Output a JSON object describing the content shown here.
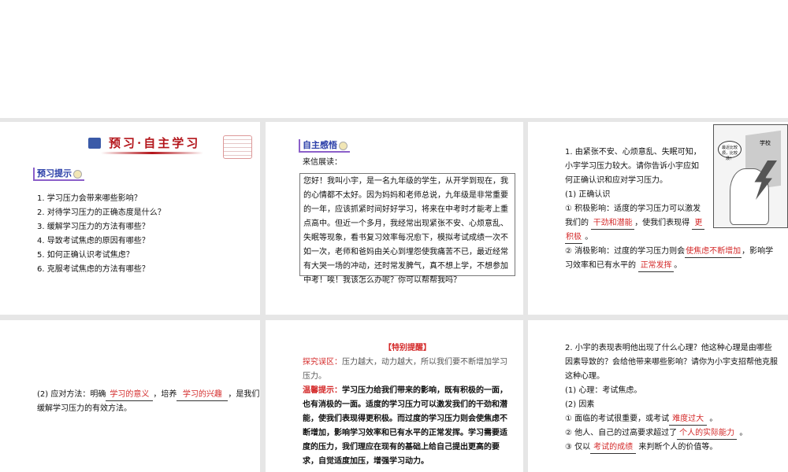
{
  "slide1": {
    "banner": "预习·自主学习",
    "section": "预习提示",
    "items": [
      "1. 学习压力会带来哪些影响？",
      "2. 对待学习压力的正确态度是什么？",
      "3. 缓解学习压力的方法有哪些？",
      "4. 导致考试焦虑的原因有哪些？",
      "5. 如何正确认识考试焦虑？",
      "6. 克服考试焦虑的方法有哪些？"
    ]
  },
  "slide2": {
    "section": "自主感悟",
    "intro": "来信展读：",
    "letter": "您好！我叫小宇，是一名九年级的学生，从开学到现在，我的心情都不太好。因为妈妈和老师总说，九年级是非常重要的一年，应该抓紧时间好好学习，将来在中考时才能考上重点高中。但近一个多月，我经常出现紧张不安、心烦意乱、失眠等现象，看书复习效率每况愈下，模拟考试成绩一次不如一次，老师和爸妈由关心到埋怨使我痛苦不已，最近经常有大哭一场的冲动，还时常发脾气，真不想上学，不想参加中考！唉！我该怎么办呢？你可以帮帮我吗？"
  },
  "slide3": {
    "q1": "1. 由紧张不安、心烦意乱、失眠可知，",
    "q2": "小宇学习压力较大。请你告诉小宇应如",
    "q3": "何正确认识和应对学习压力。",
    "h1": "(1) 正确认识",
    "p1a": "① 积极影响：适度的学习压力可以激发",
    "p1b": "我们的",
    "a1": "干劲和潜能",
    "p1c": "，使我们表现得",
    "a2a": "更",
    "a2b": "积极",
    "p1d": "。",
    "p2a": "② 消极影响：过度的学习压力则会",
    "a3": "使焦虑不断增加",
    "p2b": "，影响学",
    "p2c": "习效率和已有水平的",
    "a4": "正常发挥",
    "p2d": "。",
    "cartoon_bubble": "最近比较烦，比较烦！",
    "cartoon_sign": "学校"
  },
  "slide4": {
    "a": "(2) 应对方法：明确",
    "b1": "学习的意义",
    "b": "，培养",
    "b2": "学习的兴趣",
    "c": "，是我们",
    "d": "缓解学习压力的有效方法。"
  },
  "slide5": {
    "title": "【特别提醒】",
    "label1": "探究误区：",
    "text1a": "压力越大，动力越大，所以我们要不断增加学习",
    "text1b": "压力。",
    "label2": "温馨提示：",
    "lines": [
      "学习压力给我们带来的影响，既有积极的一面，",
      "也有消极的一面。适度的学习压力可以激发我们的干劲和潜",
      "能，使我们表现得更积极。而过度的学习压力则会使焦虑不",
      "断增加，影响学习效率和已有水平的正常发挥。学习需要适",
      "度的压力，我们理应在现有的基础上给自己提出更高的要",
      "求，自觉适度加压，增强学习动力。"
    ]
  },
  "slide6": {
    "q": [
      "2. 小宇的表现表明他出现了什么心理？他这种心理是由哪些",
      "因素导致的？会给他带来哪些影响？请你为小宇支招帮他克服",
      "这种心理。"
    ],
    "h1": "(1) 心理：考试焦虑。",
    "h2": "(2) 因素",
    "f1": "① 面临的考试很重要，或考试",
    "a1": "难度过大",
    "f2": "② 他人、自己的过高要求超过了",
    "a2": "个人的实际能力",
    "f3": "③ 仅以",
    "a3": "考试的成绩",
    "f3b": "来判断个人的价值等。",
    "dot": "。"
  }
}
